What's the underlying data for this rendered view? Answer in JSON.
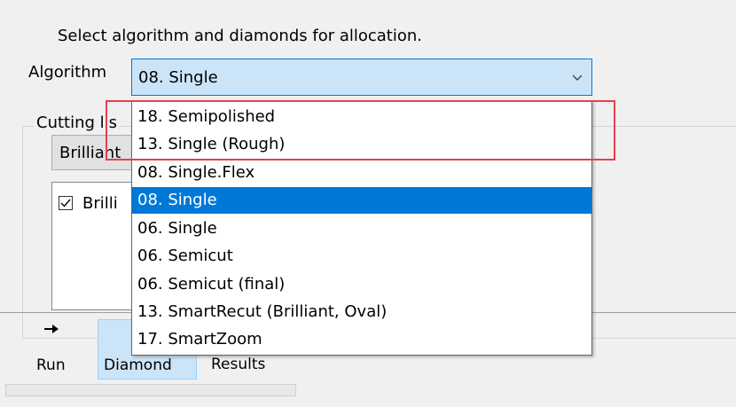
{
  "instruction": "Select algorithm and diamonds for allocation.",
  "algorithm": {
    "label": "Algorithm",
    "selected": "08. Single",
    "options": [
      "18. Semipolished",
      "13. Single (Rough)",
      "08. Single.Flex",
      "08. Single",
      "06. Single",
      "06. Semicut",
      "06. Semicut (final)",
      "13. SmartRecut (Brilliant, Oval)",
      "17. SmartZoom"
    ],
    "highlighted_index": 3
  },
  "cutting_list": {
    "legend": "Cutting lis",
    "select_value": "Brilliant",
    "item_label": "Brilli",
    "item_checked": true
  },
  "toolbar": {
    "run_label": "Run",
    "diamond_label": "Diamond",
    "results_label": "Results"
  },
  "colors": {
    "selection": "#0078d7",
    "combo_bg": "#cce4f7",
    "highlight_box": "#e8404a",
    "window_bg": "#f0f0f0"
  },
  "icons": {
    "run": "arrow-right-icon",
    "combo": "chevron-down-icon",
    "checkbox": "checkmark-icon"
  }
}
